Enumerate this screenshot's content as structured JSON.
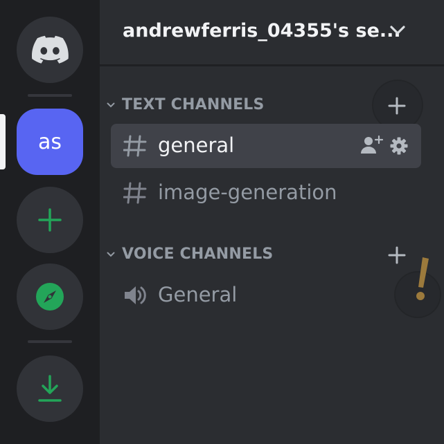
{
  "server_rail": {
    "server_initials": "as",
    "icons": {
      "home": "discord-logo-icon",
      "add": "plus-icon",
      "explore": "compass-icon",
      "download": "download-icon"
    }
  },
  "server": {
    "name": "andrewferris_04355's se..."
  },
  "categories": {
    "text": {
      "label": "TEXT CHANNELS"
    },
    "voice": {
      "label": "VOICE CHANNELS"
    }
  },
  "channels": {
    "text": [
      {
        "name": "general",
        "active": true
      },
      {
        "name": "image-generation",
        "active": false
      }
    ],
    "voice": [
      {
        "name": "General"
      }
    ]
  },
  "colors": {
    "rail_bg": "#1e1f22",
    "panel_bg": "#2b2d31",
    "server_blurple": "#5865f2",
    "green_accent": "#23a559",
    "active_channel_bg": "#404249",
    "muted_text": "#949ba4",
    "bright_text": "#f2f3f5",
    "alert_orange": "#9c7a3c"
  }
}
